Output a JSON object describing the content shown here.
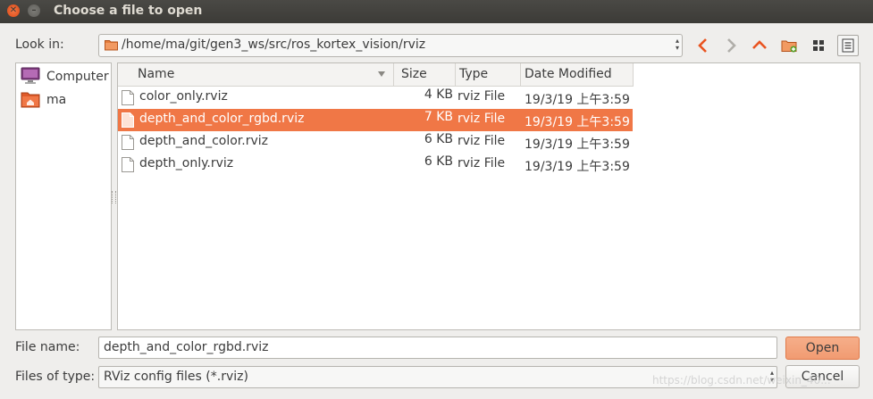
{
  "window": {
    "title": "Choose a file to open",
    "close_glyph": "✕",
    "minimize_glyph": "–"
  },
  "location": {
    "label": "Look in:",
    "path": "/home/ma/git/gen3_ws/src/ros_kortex_vision/rviz"
  },
  "toolbar": {
    "icons": [
      "back-icon",
      "forward-icon",
      "parent-folder-icon",
      "new-folder-icon",
      "grid-view-icon",
      "list-view-icon"
    ]
  },
  "places": [
    {
      "label": "Computer",
      "icon": "computer-icon"
    },
    {
      "label": "ma",
      "icon": "home-folder-icon"
    }
  ],
  "columns": [
    "Name",
    "Size",
    "Type",
    "Date Modified"
  ],
  "files": [
    {
      "name": "color_only.rviz",
      "size": "4 KB",
      "type": "rviz File",
      "date": "19/3/19 上午3:59",
      "selected": false
    },
    {
      "name": "depth_and_color_rgbd.rviz",
      "size": "7 KB",
      "type": "rviz File",
      "date": "19/3/19 上午3:59",
      "selected": true
    },
    {
      "name": "depth_and_color.rviz",
      "size": "6 KB",
      "type": "rviz File",
      "date": "19/3/19 上午3:59",
      "selected": false
    },
    {
      "name": "depth_only.rviz",
      "size": "6 KB",
      "type": "rviz File",
      "date": "19/3/19 上午3:59",
      "selected": false
    }
  ],
  "filename": {
    "label": "File name:",
    "value": "depth_and_color_rgbd.rviz"
  },
  "filetype": {
    "label": "Files of type:",
    "value": "RViz config files (*.rviz)"
  },
  "buttons": {
    "open": "Open",
    "cancel": "Cancel"
  },
  "watermark": "https://blog.csdn.net/weixin_40...",
  "colors": {
    "selection": "#f07746",
    "accent": "#e95420"
  }
}
